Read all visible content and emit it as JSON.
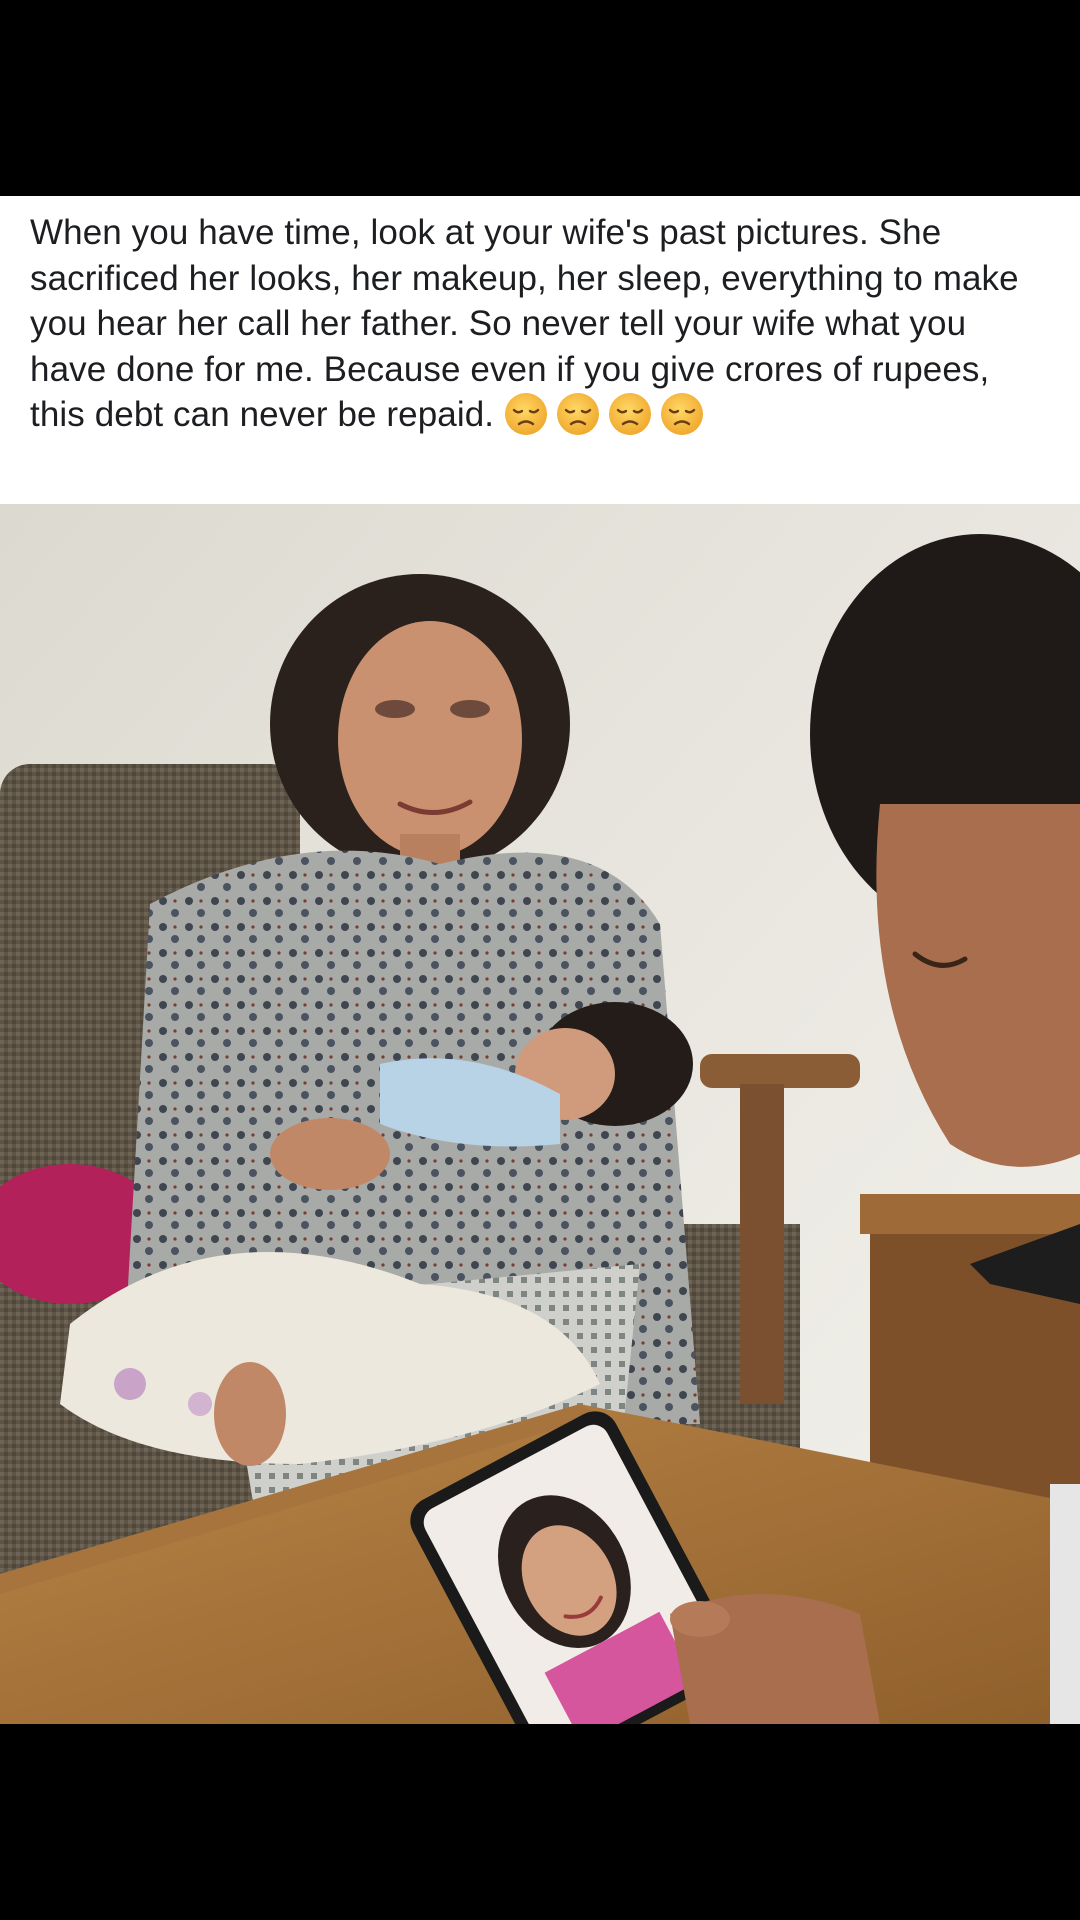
{
  "post": {
    "caption": "When you have time, look at your wife's past pictures. She sacrificed her looks, her makeup, her sleep, everything to make you hear her call her father. So never tell your wife what you have done for me. Because even if you give crores of rupees, this debt can never be repaid.",
    "emojis": [
      "disappointed-face",
      "disappointed-face",
      "disappointed-face",
      "disappointed-face"
    ],
    "emoji_color": "#f5b83a"
  },
  "photo": {
    "icon": "photo"
  },
  "colors": {
    "background": "#000000",
    "caption_background": "#ffffff",
    "caption_text": "#1c1e21"
  }
}
